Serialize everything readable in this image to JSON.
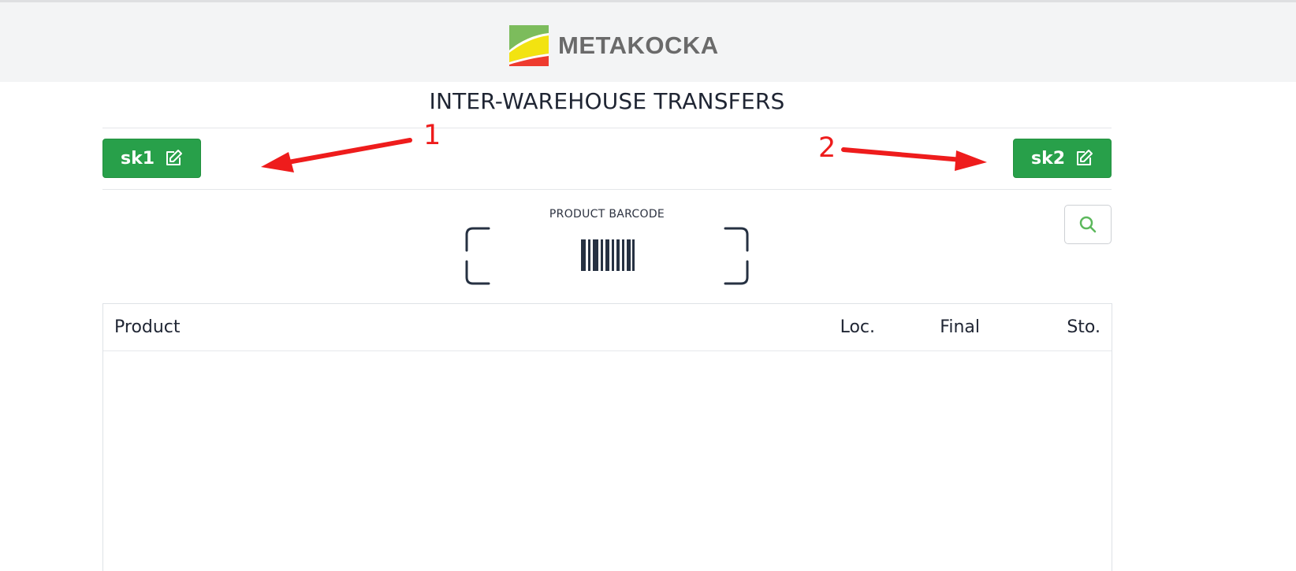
{
  "header": {
    "logo_text": "METAKOCKA"
  },
  "page": {
    "title": "INTER-WAREHOUSE TRANSFERS"
  },
  "warehouses": {
    "source_label": "sk1",
    "destination_label": "sk2"
  },
  "annotations": {
    "first": "1",
    "second": "2"
  },
  "barcode": {
    "label": "PRODUCT BARCODE"
  },
  "table": {
    "columns": [
      "Product",
      "Loc.",
      "Final",
      "Sto."
    ]
  },
  "colors": {
    "button_green": "#28a04a",
    "annotation_red": "#ee1c1c",
    "search_icon_green": "#5cb85c"
  },
  "icons": [
    "logo-icon",
    "edit-icon",
    "barcode-icon",
    "search-icon"
  ]
}
